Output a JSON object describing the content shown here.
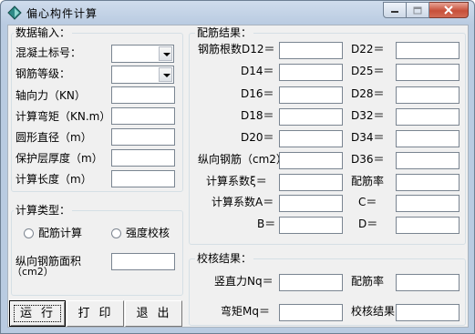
{
  "window": {
    "title": "偏心构件计算"
  },
  "input_group": {
    "title": "数据输入：",
    "concrete_grade_label": "混凝土标号：",
    "rebar_grade_label": "钢筋等级：",
    "axial_force_label": "轴向力（KN）",
    "moment_label": "计算弯矩（KN.m）",
    "diameter_label": "圆形直径（m）",
    "cover_label": "保护层厚度（m）",
    "length_label": "计算长度（m）"
  },
  "calc_type_group": {
    "title": "计算类型：",
    "option_reinforcement": "配筋计算",
    "option_strength": "强度校核",
    "rebar_area_label": "纵向钢筋面积",
    "rebar_area_unit": "（cm2）"
  },
  "buttons": {
    "run": "运行",
    "print": "打印",
    "exit": "退出"
  },
  "result_group": {
    "title": "配筋结果：",
    "count_d12": "钢筋根数D12＝",
    "d14": "D14＝",
    "d16": "D16＝",
    "d18": "D18＝",
    "d20": "D20＝",
    "d22": "D22＝",
    "d25": "D25＝",
    "d28": "D28＝",
    "d32": "D32＝",
    "d34": "D34＝",
    "d36": "D36＝",
    "long_rebar": "纵向钢筋（cm2）",
    "coef_xi": "计算系数ξ＝",
    "ratio": "配筋率",
    "coef_a": "计算系数A＝",
    "c": "C＝",
    "b": "B＝",
    "d": "D＝"
  },
  "check_group": {
    "title": "校核结果：",
    "vertical_force": "竖直力Nq＝",
    "ratio": "配筋率",
    "moment": "弯矩Mq＝",
    "check_result": "校核结果"
  }
}
